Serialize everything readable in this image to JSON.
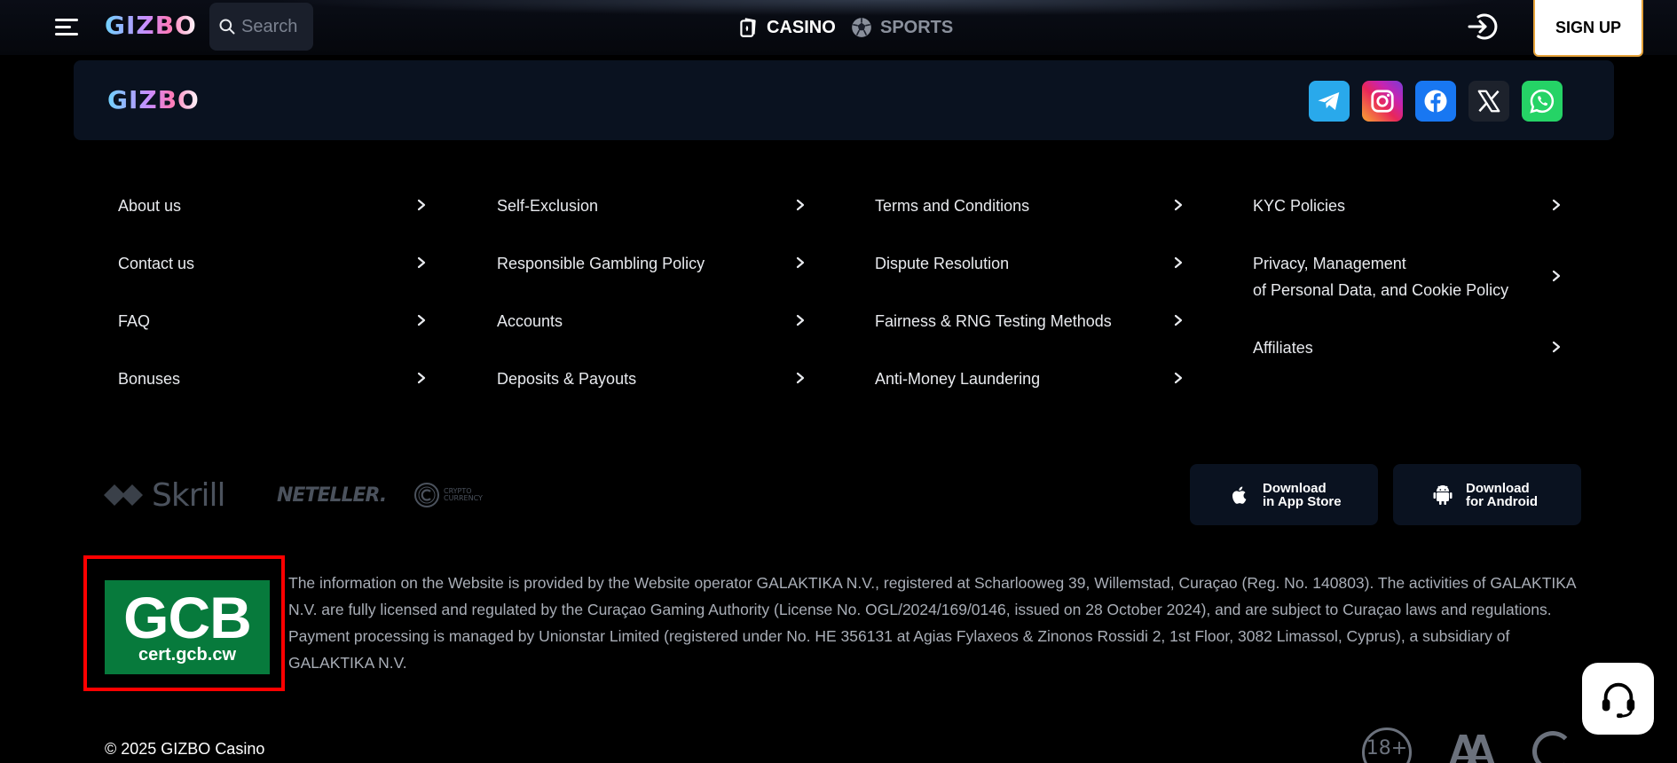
{
  "header": {
    "logo": "GIZBO",
    "search_placeholder": "Search",
    "nav": [
      {
        "label": "CASINO",
        "icon": "cards-icon",
        "active": true
      },
      {
        "label": "SPORTS",
        "icon": "soccer-ball-icon",
        "active": false
      }
    ],
    "signup_label": "SIGN UP"
  },
  "footer": {
    "logo": "GIZBO",
    "socials": [
      "telegram-icon",
      "instagram-icon",
      "facebook-icon",
      "x-icon",
      "whatsapp-icon"
    ],
    "links": {
      "col1": [
        "About us",
        "Contact us",
        "FAQ",
        "Bonuses"
      ],
      "col2": [
        "Self-Exclusion",
        "Responsible Gambling Policy",
        "Accounts",
        "Deposits & Payouts"
      ],
      "col3": [
        "Terms and Conditions",
        "Dispute Resolution",
        "Fairness & RNG Testing Methods",
        "Anti-Money Laundering"
      ],
      "col4": [
        "KYC Policies",
        "Privacy, Management",
        "of Personal Data, and Cookie Policy",
        "Affiliates"
      ]
    },
    "payments": {
      "skrill": "Skrill",
      "neteller": "NETELLER.",
      "crypto_line1": "CRYPTO",
      "crypto_line2": "CURRENCY"
    },
    "apps": {
      "ios_line1": "Download",
      "ios_line2": "in App Store",
      "android_line1": "Download",
      "android_line2": "for Android"
    },
    "license": {
      "badge_big": "GCB",
      "badge_small": "cert.gcb.cw",
      "text": "The information on the Website is provided by the Website operator GALAKTIKA N.V., registered at Scharlooweg 39, Willemstad, Curaçao (Reg. No. 140803). The activities of GALAKTIKA N.V. are fully licensed and regulated by the Curaçao Gaming Authority (License No. OGL/2024/169/0146, issued on 28 October 2024), and are subject to Curaçao laws and regulations. Payment processing is managed by Unionstar Limited (registered under No. HE 356131 at Agias Fylaxeos & Zinonos Rossidi 2, 1st Floor, 3082 Limassol, Cyprus), a subsidiary of GALAKTIKA N.V."
    },
    "copyright": "© 2025 GIZBO Casino",
    "badges": {
      "age": "18+"
    }
  },
  "colors": {
    "background": "#000000",
    "card": "#0a1220",
    "license_highlight": "#ff0000",
    "gcb_green": "#077a3c",
    "signup_border": "#e6a33a"
  }
}
